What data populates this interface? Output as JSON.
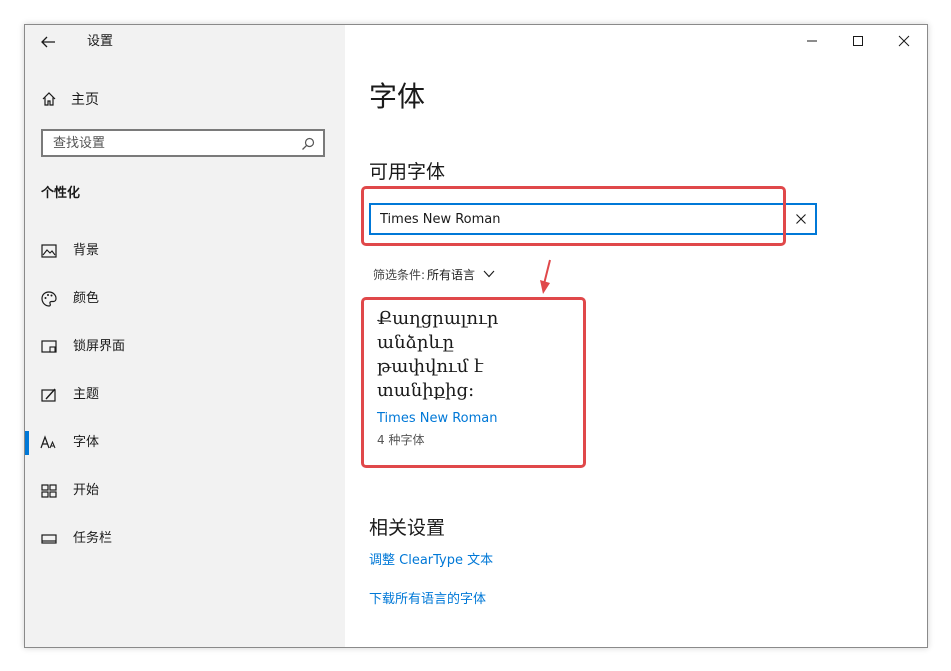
{
  "sidebar": {
    "app_title": "设置",
    "home_label": "主页",
    "search_placeholder": "查找设置",
    "section_label": "个性化",
    "items": [
      {
        "label": "背景",
        "icon": "image-icon"
      },
      {
        "label": "颜色",
        "icon": "palette-icon"
      },
      {
        "label": "锁屏界面",
        "icon": "lock-screen-icon"
      },
      {
        "label": "主题",
        "icon": "theme-icon"
      },
      {
        "label": "字体",
        "icon": "font-icon",
        "selected": true
      },
      {
        "label": "开始",
        "icon": "start-icon"
      },
      {
        "label": "任务栏",
        "icon": "taskbar-icon"
      }
    ]
  },
  "main": {
    "page_title": "字体",
    "available_title": "可用字体",
    "font_search_value": "Times New Roman",
    "filter_key": "筛选条件:",
    "filter_value": "所有语言",
    "card": {
      "sample_lines": [
        "Քաղցրալուր",
        "անձրևը",
        "թափվում է",
        "տանիքից:"
      ],
      "font_name": "Times New Roman",
      "count": "4 种字体"
    },
    "related_title": "相关设置",
    "link_cleartype": "调整 ClearType 文本",
    "link_download": "下载所有语言的字体"
  },
  "colors": {
    "accent": "#0078d7",
    "highlight": "#e0484a",
    "sidebar_bg": "#f2f2f2"
  }
}
